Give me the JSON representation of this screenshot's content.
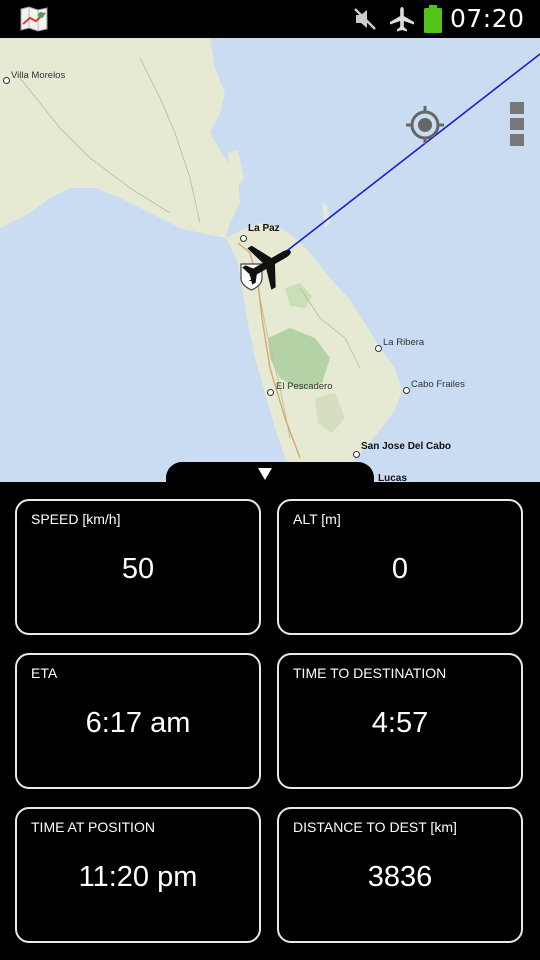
{
  "status_bar": {
    "time": "07:20",
    "battery_color": "#52c41a",
    "icons": [
      "map-app-icon",
      "muted-icon",
      "airplane-mode-icon",
      "battery-icon"
    ]
  },
  "map": {
    "places": [
      {
        "name": "Villa Morelos",
        "bold": false
      },
      {
        "name": "La Paz",
        "bold": true
      },
      {
        "name": "La Ribera",
        "bold": false
      },
      {
        "name": "El Pescadero",
        "bold": false
      },
      {
        "name": "Cabo Frailes",
        "bold": false
      },
      {
        "name": "San Jose Del Cabo",
        "bold": true
      },
      {
        "name": "Lucas",
        "bold": true
      }
    ],
    "highway_shield": "1",
    "route_color": "#1a1adb",
    "water_color": "#c9dcf2",
    "land_color": "#e6ead2"
  },
  "cards": [
    {
      "label": "SPEED [km/h]",
      "value": "50"
    },
    {
      "label": "ALT [m]",
      "value": "0"
    },
    {
      "label": "ETA",
      "value": "6:17 am"
    },
    {
      "label": "TIME TO DESTINATION",
      "value": "4:57"
    },
    {
      "label": "TIME AT POSITION",
      "value": "11:20 pm"
    },
    {
      "label": "DISTANCE TO DEST [km]",
      "value": "3836"
    }
  ]
}
